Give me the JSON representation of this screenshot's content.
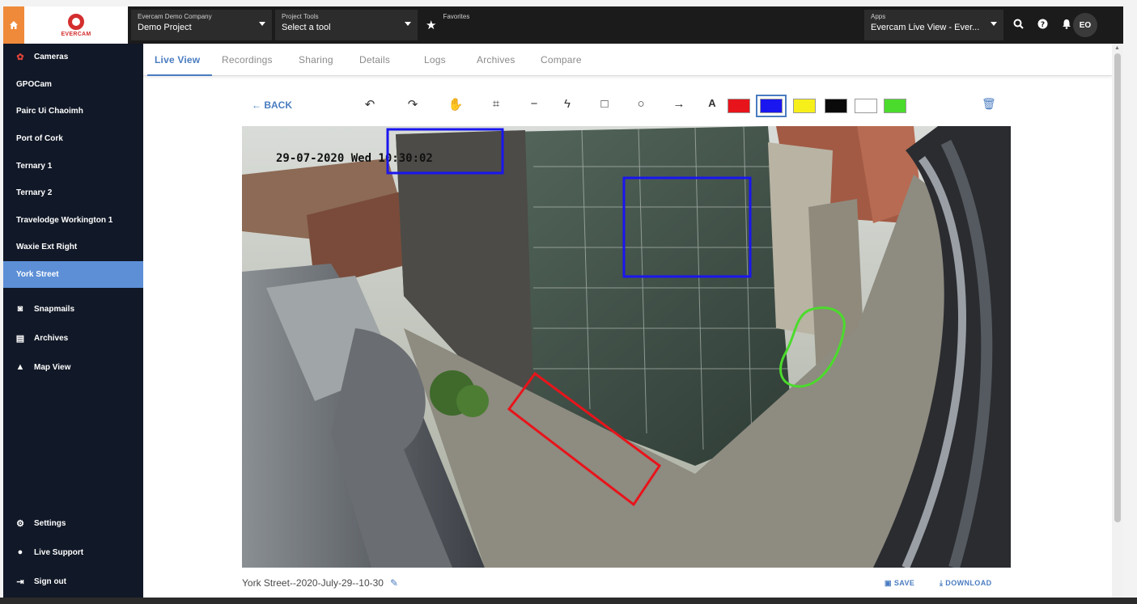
{
  "topbar": {
    "logo_text": "EVERCAM",
    "company": {
      "label": "Evercam Demo Company",
      "value": "Demo Project"
    },
    "tools": {
      "label": "Project Tools",
      "value": "Select a tool"
    },
    "favorites": "Favorites",
    "apps": {
      "label": "Apps",
      "value": "Evercam Live View - Ever..."
    },
    "avatar": "EO"
  },
  "sidebar": {
    "header": "Cameras",
    "cameras": [
      "GPOCam",
      "Pairc Ui Chaoimh",
      "Port of Cork",
      "Ternary 1",
      "Ternary 2",
      "Travelodge Workington 1",
      "Waxie Ext Right",
      "York Street"
    ],
    "active_index": 7,
    "sections": [
      "Snapmails",
      "Archives",
      "Map View"
    ],
    "bottom": [
      "Settings",
      "Live Support",
      "Sign out"
    ],
    "progress": 0.2
  },
  "tabs": [
    "Live View",
    "Recordings",
    "Sharing",
    "Details",
    "Logs",
    "Archives",
    "Compare"
  ],
  "toolbar": {
    "back": "← BACK",
    "colors": [
      "#e8141b",
      "#1a16ef",
      "#f7ef1a",
      "#0a0a0a",
      "#ffffff",
      "#4bdb2c"
    ],
    "selected_color_index": 1
  },
  "photo": {
    "timestamp": "29-07-2020 Wed 10:30:02"
  },
  "footer": {
    "caption": "York Street--2020-July-29--10-30",
    "save": "SAVE",
    "download": "DOWNLOAD"
  }
}
